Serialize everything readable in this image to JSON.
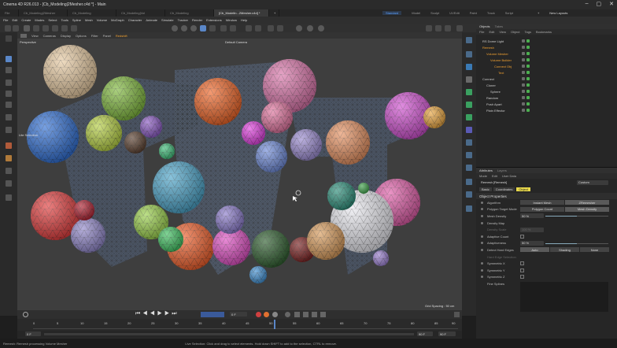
{
  "window": {
    "title": "Cinema 4D R26.013 - [Cb_Modeling|2Mesher.c4d *] - Main",
    "controls": [
      "–",
      "▢",
      "✕"
    ]
  },
  "tabs": [
    {
      "label": "File"
    },
    {
      "label": "Cb_Modeling|2Mesher"
    },
    {
      "label": "Cb_Modeling"
    },
    {
      "label": "Cb_Modeling|Vol"
    },
    {
      "label": "Cb_Modeling"
    },
    {
      "label": "[Cb_Modelin...2Mesher.c4d] *",
      "active": true
    }
  ],
  "layouts": {
    "items": [
      "Standard",
      "Model",
      "Sculpt",
      "UVEdit",
      "Paint",
      "Track",
      "Script"
    ],
    "active": "Standard",
    "new_layouts": "New Layouts"
  },
  "menubar": [
    "File",
    "Edit",
    "Create",
    "Modes",
    "Select",
    "Tools",
    "Spline",
    "Mesh",
    "Volume",
    "MoGraph",
    "Character",
    "Animate",
    "Simulate",
    "Tracker",
    "Render",
    "Extensions",
    "Window",
    "Help"
  ],
  "viewport": {
    "menu": [
      "View",
      "Cameras",
      "Display",
      "Options",
      "Filter",
      "Panel",
      "Redshift"
    ],
    "label": "Perspective",
    "camera": "Default Camera",
    "grid_spacing": "Grid Spacing : 50 cm",
    "sub_label": "Lite Selection"
  },
  "timeline": {
    "ticks": [
      "0",
      "5",
      "10",
      "15",
      "20",
      "25",
      "30",
      "35",
      "40",
      "45",
      "50",
      "55",
      "60",
      "65",
      "70",
      "75",
      "80",
      "85",
      "90"
    ],
    "current_frame": "0 F",
    "frame_field": "90 F",
    "start": "0 F",
    "end": "90 F"
  },
  "objects_panel": {
    "tabs": [
      "Objects",
      "Takes"
    ],
    "menu": [
      "File",
      "Edit",
      "View",
      "Object",
      "Tags",
      "Bookmarks"
    ],
    "items": [
      {
        "name": "RS Dome Light",
        "indent": 0
      },
      {
        "name": "Remesh",
        "indent": 0
      },
      {
        "name": "Volume Mesher",
        "indent": 1,
        "color": "orange"
      },
      {
        "name": "Volume Builder",
        "indent": 2,
        "color": "orange"
      },
      {
        "name": "Connect Obj",
        "indent": 3,
        "color": "orange"
      },
      {
        "name": "Text",
        "indent": 4,
        "color": "orange"
      },
      {
        "name": "Connect",
        "indent": 0
      },
      {
        "name": "Cloner",
        "indent": 1
      },
      {
        "name": "Sphere",
        "indent": 2
      },
      {
        "name": "Random",
        "indent": 1
      },
      {
        "name": "Push Apart",
        "indent": 1
      },
      {
        "name": "Plain Effector",
        "indent": 1
      }
    ]
  },
  "attributes_panel": {
    "tabs": [
      "Attributes",
      "Layers"
    ],
    "menu": [
      "Mode",
      "Edit",
      "User Data"
    ],
    "object": "Remesh [Remesh]",
    "preset": "Custom",
    "sub_tabs": [
      "Basic",
      "Coordinates",
      "Object"
    ],
    "active_sub_tab": "Object",
    "section": "Object Properties",
    "props": [
      {
        "label": "Algorithm",
        "kind": "segmented",
        "options": [
          "Instant Mesh",
          "ZRemesher"
        ],
        "selected": 1
      },
      {
        "label": "Polygon Target Mode",
        "kind": "segmented",
        "options": [
          "Polygon Count",
          "Mesh Density"
        ],
        "selected": 1
      },
      {
        "label": "Mesh Density",
        "kind": "slider",
        "value": "50 %",
        "level": 0.5
      },
      {
        "label": "Density Map",
        "kind": "empty"
      },
      {
        "label": "Density Scale",
        "kind": "field",
        "value": "100 %",
        "dim": true
      },
      {
        "label": "Adaptive Count",
        "kind": "check"
      },
      {
        "label": "Adaptiveness",
        "kind": "slider",
        "value": "50 %",
        "level": 0.5
      },
      {
        "label": "Detect Hard Edges",
        "kind": "segmented3",
        "options": [
          "Auto",
          "Shading",
          "None"
        ],
        "selected": 0
      },
      {
        "label": "Hard Edge Selection",
        "kind": "empty",
        "dim": true
      },
      {
        "label": "Symmetric X",
        "kind": "check"
      },
      {
        "label": "Symmetric Y",
        "kind": "check"
      },
      {
        "label": "Symmetric Z",
        "kind": "check"
      },
      {
        "label": "Fine Splines",
        "kind": "box"
      }
    ]
  },
  "status": {
    "left": "Remesh: Remesh processing Volume Mesher",
    "right": "Live Selection: Click and drag to select elements. Hold down SHIFT to add to the selection, CTRL to remove."
  }
}
